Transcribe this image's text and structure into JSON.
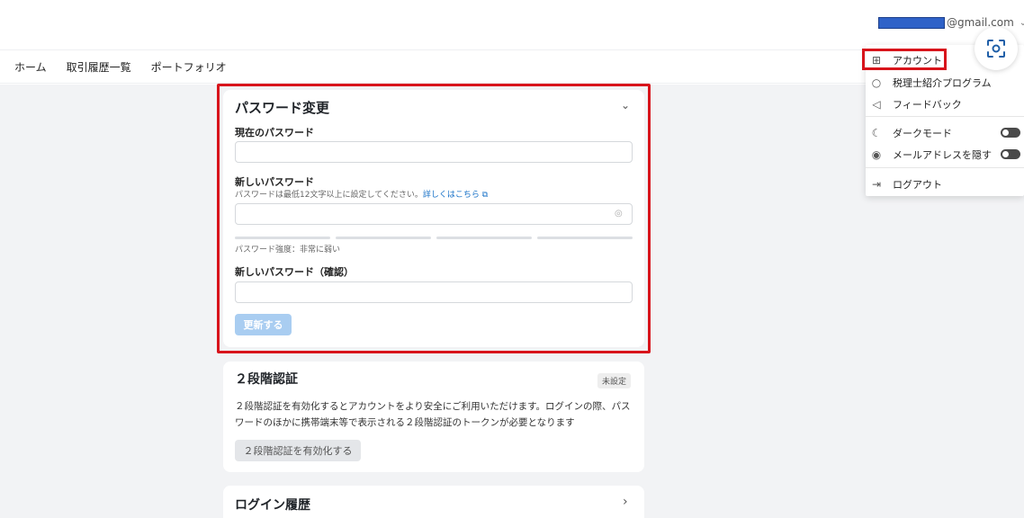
{
  "header": {
    "email_suffix": "@gmail.com",
    "email_chevron": "⌄"
  },
  "nav": {
    "items": [
      "ホーム",
      "取引履歴一覧",
      "ポートフォリオ"
    ]
  },
  "password_card": {
    "title": "パスワード変更",
    "collapse_icon": "⌄",
    "current_label": "現在のパスワード",
    "new_label": "新しいパスワード",
    "new_hint": "パスワードは最低12文字以上に設定してください。",
    "new_hint_link": "詳しくはこちら ⧉",
    "strength_label": "パスワード強度：非常に弱い",
    "confirm_label": "新しいパスワード（確認）",
    "submit_label": "更新する"
  },
  "twofa_card": {
    "title": "２段階認証",
    "badge": "未設定",
    "description": "２段階認証を有効化するとアカウントをより安全にご利用いただけます。ログインの際、パスワードのほかに携帯端末等で表示される２段階認証のトークンが必要となります",
    "button_label": "２段階認証を有効化する"
  },
  "login_card": {
    "title": "ログイン履歴",
    "arrow": "›"
  },
  "dropdown": {
    "items": [
      {
        "label": "アカウント",
        "icon": "account-icon",
        "glyph": "⊞"
      },
      {
        "label": "税理士紹介プログラム",
        "icon": "search-icon",
        "glyph": "○"
      },
      {
        "label": "フィードバック",
        "icon": "send-icon",
        "glyph": "◁"
      },
      {
        "label": "ダークモード",
        "icon": "moon-icon",
        "glyph": "☾",
        "toggle": true
      },
      {
        "label": "メールアドレスを隠す",
        "icon": "eye-icon",
        "glyph": "◉",
        "toggle": true
      },
      {
        "label": "ログアウト",
        "icon": "logout-icon",
        "glyph": "⇥"
      }
    ]
  },
  "colors": {
    "highlight": "#d8141b",
    "accent": "#1a73c8",
    "button_disabled": "#a9cdf1"
  }
}
